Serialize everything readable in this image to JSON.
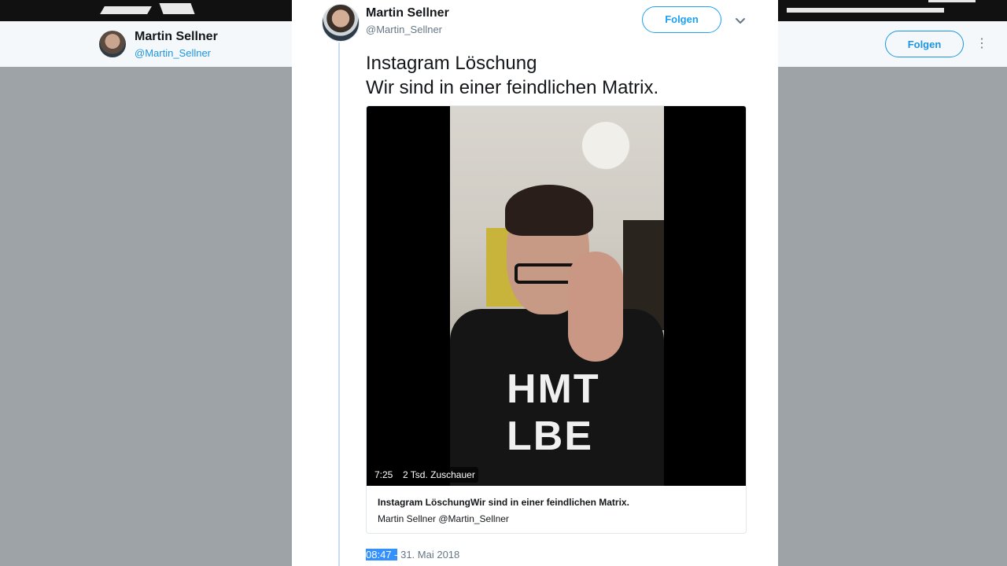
{
  "background_profile": {
    "name": "Martin Sellner",
    "handle": "@Martin_Sellner",
    "follow_label": "Folgen",
    "more_icon": "vertical-ellipsis"
  },
  "tweet": {
    "author_name": "Martin Sellner",
    "author_handle": "@Martin_Sellner",
    "follow_label": "Folgen",
    "caret_icon": "chevron-down",
    "text_line1": "Instagram Löschung",
    "text_line2": "Wir sind in einer feindlichen Matrix.",
    "video": {
      "duration": "7:25",
      "viewers": "2 Tsd. Zuschauer",
      "card_title": "Instagram LöschungWir sind in einer feindlichen Matrix.",
      "card_author": "Martin Sellner @Martin_Sellner",
      "shirt_print": "HMT LBE"
    },
    "time_selected": "08:47 -",
    "date": " 31. Mai 2018"
  },
  "colors": {
    "accent": "#1da1f2",
    "overlay": "#9ea3a7",
    "text": "#14171a",
    "muted": "#657786",
    "selection": "#3390ff"
  }
}
